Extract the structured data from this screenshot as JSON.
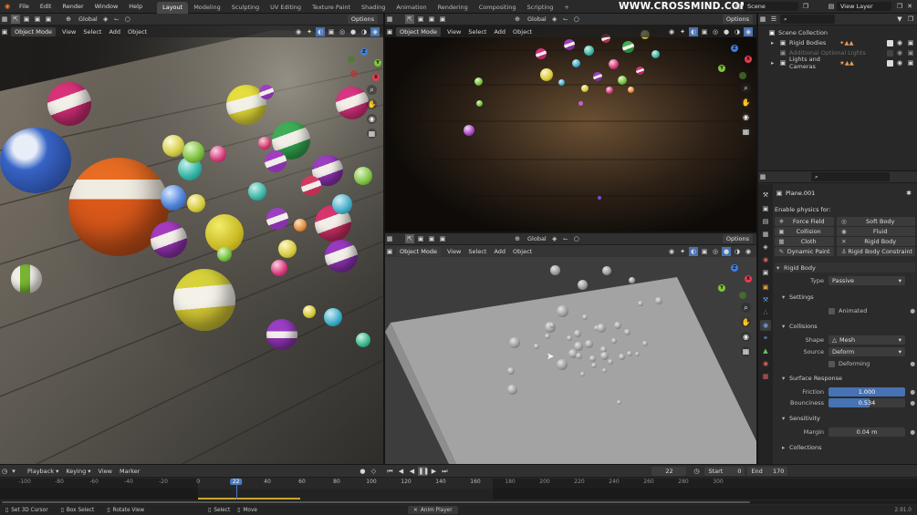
{
  "topbar": {
    "menus": [
      "File",
      "Edit",
      "Render",
      "Window",
      "Help"
    ],
    "workspaces": [
      "Layout",
      "Modeling",
      "Sculpting",
      "UV Editing",
      "Texture Paint",
      "Shading",
      "Animation",
      "Rendering",
      "Compositing",
      "Scripting"
    ],
    "active_workspace": "Layout",
    "add_tab": "+",
    "watermark": "WWW.CROSSMIND.COM",
    "scene_name": "Scene",
    "view_layer": "View Layer"
  },
  "viewport_toolbar": {
    "orientation": "Global",
    "options": "Options"
  },
  "viewport_header": {
    "mode": "Object Mode",
    "menus": [
      "View",
      "Select",
      "Add",
      "Object"
    ]
  },
  "outliner": {
    "items": [
      {
        "label": "Scene Collection",
        "level": 0
      },
      {
        "label": "Rigid Bodies",
        "level": 1
      },
      {
        "label": "Additional Optional Lights",
        "level": 1
      },
      {
        "label": "Lights and Cameras",
        "level": 1
      }
    ]
  },
  "properties": {
    "object_name": "Plane.001",
    "enable_physics_label": "Enable physics for:",
    "physics_buttons": [
      {
        "label": "Force Field",
        "icon": "force-field-icon"
      },
      {
        "label": "Soft Body",
        "icon": "soft-body-icon"
      },
      {
        "label": "Collision",
        "icon": "collision-icon"
      },
      {
        "label": "Fluid",
        "icon": "fluid-icon"
      },
      {
        "label": "Cloth",
        "icon": "cloth-icon"
      },
      {
        "label": "Rigid Body",
        "icon": "close-icon"
      },
      {
        "label": "Dynamic Paint",
        "icon": "dynamic-paint-icon"
      },
      {
        "label": "Rigid Body Constraint",
        "icon": "constraint-icon"
      }
    ],
    "rigid_body": {
      "title": "Rigid Body",
      "type_label": "Type",
      "type_value": "Passive"
    },
    "settings": {
      "title": "Settings",
      "animated_label": "Animated"
    },
    "collisions": {
      "title": "Collisions",
      "shape_label": "Shape",
      "shape_value": "Mesh",
      "source_label": "Source",
      "source_value": "Deform",
      "deforming_label": "Deforming"
    },
    "surface_response": {
      "title": "Surface Response",
      "friction_label": "Friction",
      "friction_value": "1.000",
      "friction_fraction": 1.0,
      "bounciness_label": "Bounciness",
      "bounciness_value": "0.534",
      "bounciness_fraction": 0.534
    },
    "sensitivity": {
      "title": "Sensitivity",
      "margin_label": "Margin",
      "margin_value": "0.04 m"
    },
    "collections": {
      "title": "Collections"
    }
  },
  "timeline": {
    "menus": [
      "Playback",
      "Keying",
      "View",
      "Marker"
    ],
    "current_frame": "22",
    "start_label": "Start",
    "start_value": "0",
    "end_label": "End",
    "end_value": "170",
    "ruler": [
      "-100",
      "-80",
      "-60",
      "-40",
      "-20",
      "0",
      "22",
      "40",
      "60",
      "80",
      "100",
      "120",
      "140",
      "160",
      "180",
      "200",
      "220",
      "240",
      "260",
      "280",
      "300"
    ],
    "ruler_values": [
      -100,
      -80,
      -60,
      -40,
      -20,
      0,
      22,
      40,
      60,
      80,
      100,
      120,
      140,
      160,
      180,
      200,
      220,
      240,
      260,
      280,
      300
    ]
  },
  "statusbar": {
    "items": [
      "Set 3D Cursor",
      "Box Select",
      "Rotate View",
      "Select",
      "Move"
    ],
    "anim_player": "Anim Player",
    "version": "2.91.0"
  },
  "colors": {
    "accent": "#4772b3",
    "active_workspace": "#474747",
    "playhead": "#4b7bc4",
    "gizmo_x": "#e63d52",
    "gizmo_y": "#7ac736",
    "gizmo_z": "#3d7ee6"
  }
}
